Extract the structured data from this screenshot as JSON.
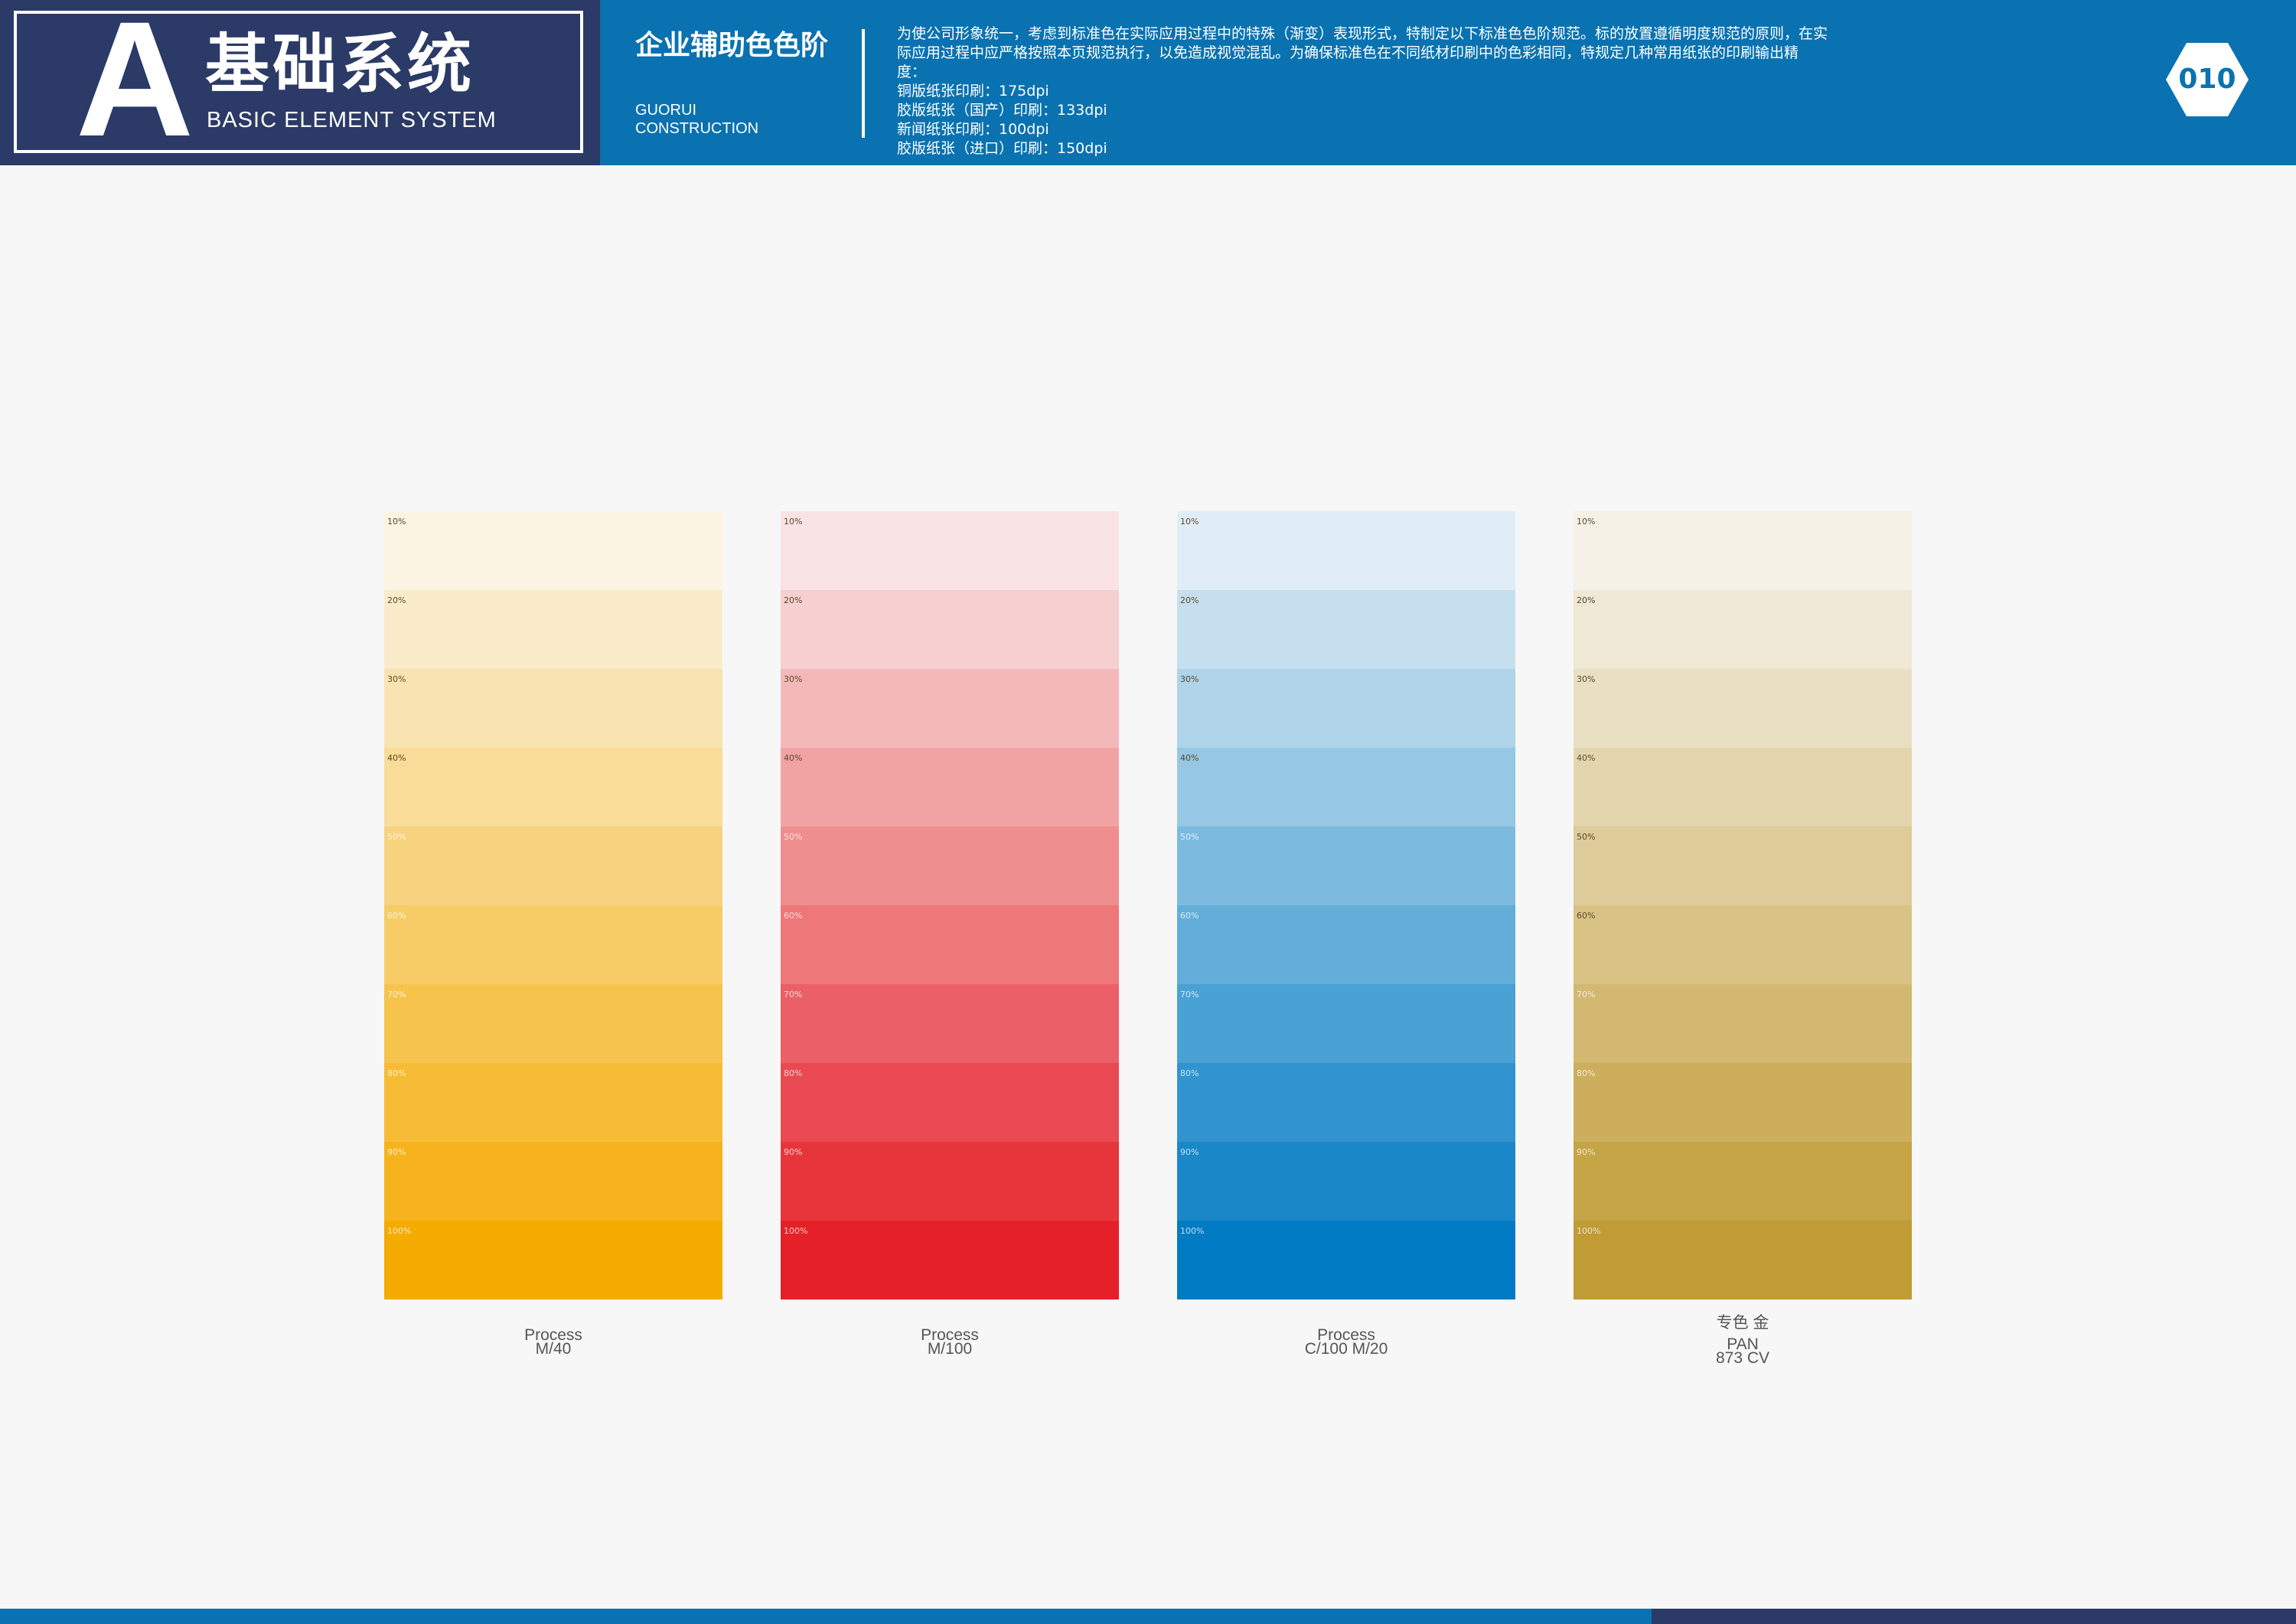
{
  "header": {
    "brand_letter": "A",
    "brand_cn": "基础系统",
    "brand_en": "BASIC ELEMENT SYSTEM",
    "section_title": "企业辅助色色阶",
    "company_lines": [
      "GUORUI",
      "CONSTRUCTION"
    ],
    "description_lines": [
      "为使公司形象统一，考虑到标准色在实际应用过程中的特殊（渐变）表现形式，特制定以下标准色色阶规范。标的放置遵循明度规范的原则，在实",
      "际应用过程中应严格按照本页规范执行，以免造成视觉混乱。为确保标准色在不同纸材印刷中的色彩相同，特规定几种常用纸张的印刷输出精",
      "度：",
      "铜版纸张印刷：175dpi",
      "胶版纸张（国产）印刷：133dpi",
      "新闻纸张印刷：100dpi",
      "胶版纸张（进口）印刷：150dpi"
    ],
    "page_number": "010"
  },
  "colors": {
    "header_blue": "#0a72b0",
    "brand_navy": "#2b3a66",
    "background": "#f7f7f7"
  },
  "palettes": [
    {
      "name": "yellow",
      "caption_lines": [
        "Process",
        "M/40"
      ],
      "tints": [
        {
          "label": "10%",
          "color": "#fbf4e2"
        },
        {
          "label": "20%",
          "color": "#faecc9"
        },
        {
          "label": "30%",
          "color": "#f9e4b1"
        },
        {
          "label": "40%",
          "color": "#f8dc98"
        },
        {
          "label": "50%",
          "color": "#f7d37f"
        },
        {
          "label": "60%",
          "color": "#f7cc66"
        },
        {
          "label": "70%",
          "color": "#f6c44d"
        },
        {
          "label": "80%",
          "color": "#f6bc35"
        },
        {
          "label": "90%",
          "color": "#f6b31d"
        },
        {
          "label": "100%",
          "color": "#f5ab00"
        }
      ]
    },
    {
      "name": "red",
      "caption_lines": [
        "Process",
        "M/100"
      ],
      "tints": [
        {
          "label": "10%",
          "color": "#f9e3e4"
        },
        {
          "label": "20%",
          "color": "#f6cfd0"
        },
        {
          "label": "30%",
          "color": "#f4b8b9"
        },
        {
          "label": "40%",
          "color": "#f1a3a3"
        },
        {
          "label": "50%",
          "color": "#ef8e8e"
        },
        {
          "label": "60%",
          "color": "#ee7779"
        },
        {
          "label": "70%",
          "color": "#eb6067"
        },
        {
          "label": "80%",
          "color": "#e94a51"
        },
        {
          "label": "90%",
          "color": "#e6363c"
        },
        {
          "label": "100%",
          "color": "#e52028"
        }
      ]
    },
    {
      "name": "blue",
      "caption_lines": [
        "Process",
        "C/100 M/20"
      ],
      "tints": [
        {
          "label": "10%",
          "color": "#e0edf6"
        },
        {
          "label": "20%",
          "color": "#c6dfef"
        },
        {
          "label": "30%",
          "color": "#afd3e9"
        },
        {
          "label": "40%",
          "color": "#96c7e4"
        },
        {
          "label": "50%",
          "color": "#7cbadf"
        },
        {
          "label": "60%",
          "color": "#63aed9"
        },
        {
          "label": "70%",
          "color": "#4aa1d3"
        },
        {
          "label": "80%",
          "color": "#3194cf"
        },
        {
          "label": "90%",
          "color": "#1a87c9"
        },
        {
          "label": "100%",
          "color": "#007bc4"
        }
      ]
    },
    {
      "name": "gold",
      "caption_lines": [
        "专色 金",
        "PAN",
        "873 CV"
      ],
      "tints": [
        {
          "label": "10%",
          "color": "#f6f1e6"
        },
        {
          "label": "20%",
          "color": "#efe8d5"
        },
        {
          "label": "30%",
          "color": "#e9dfc2"
        },
        {
          "label": "40%",
          "color": "#e3d5ae"
        },
        {
          "label": "50%",
          "color": "#ddcb99"
        },
        {
          "label": "60%",
          "color": "#d8c284"
        },
        {
          "label": "70%",
          "color": "#d2b871"
        },
        {
          "label": "80%",
          "color": "#ccae5c"
        },
        {
          "label": "90%",
          "color": "#c6a547"
        },
        {
          "label": "100%",
          "color": "#c09b36"
        }
      ]
    }
  ]
}
